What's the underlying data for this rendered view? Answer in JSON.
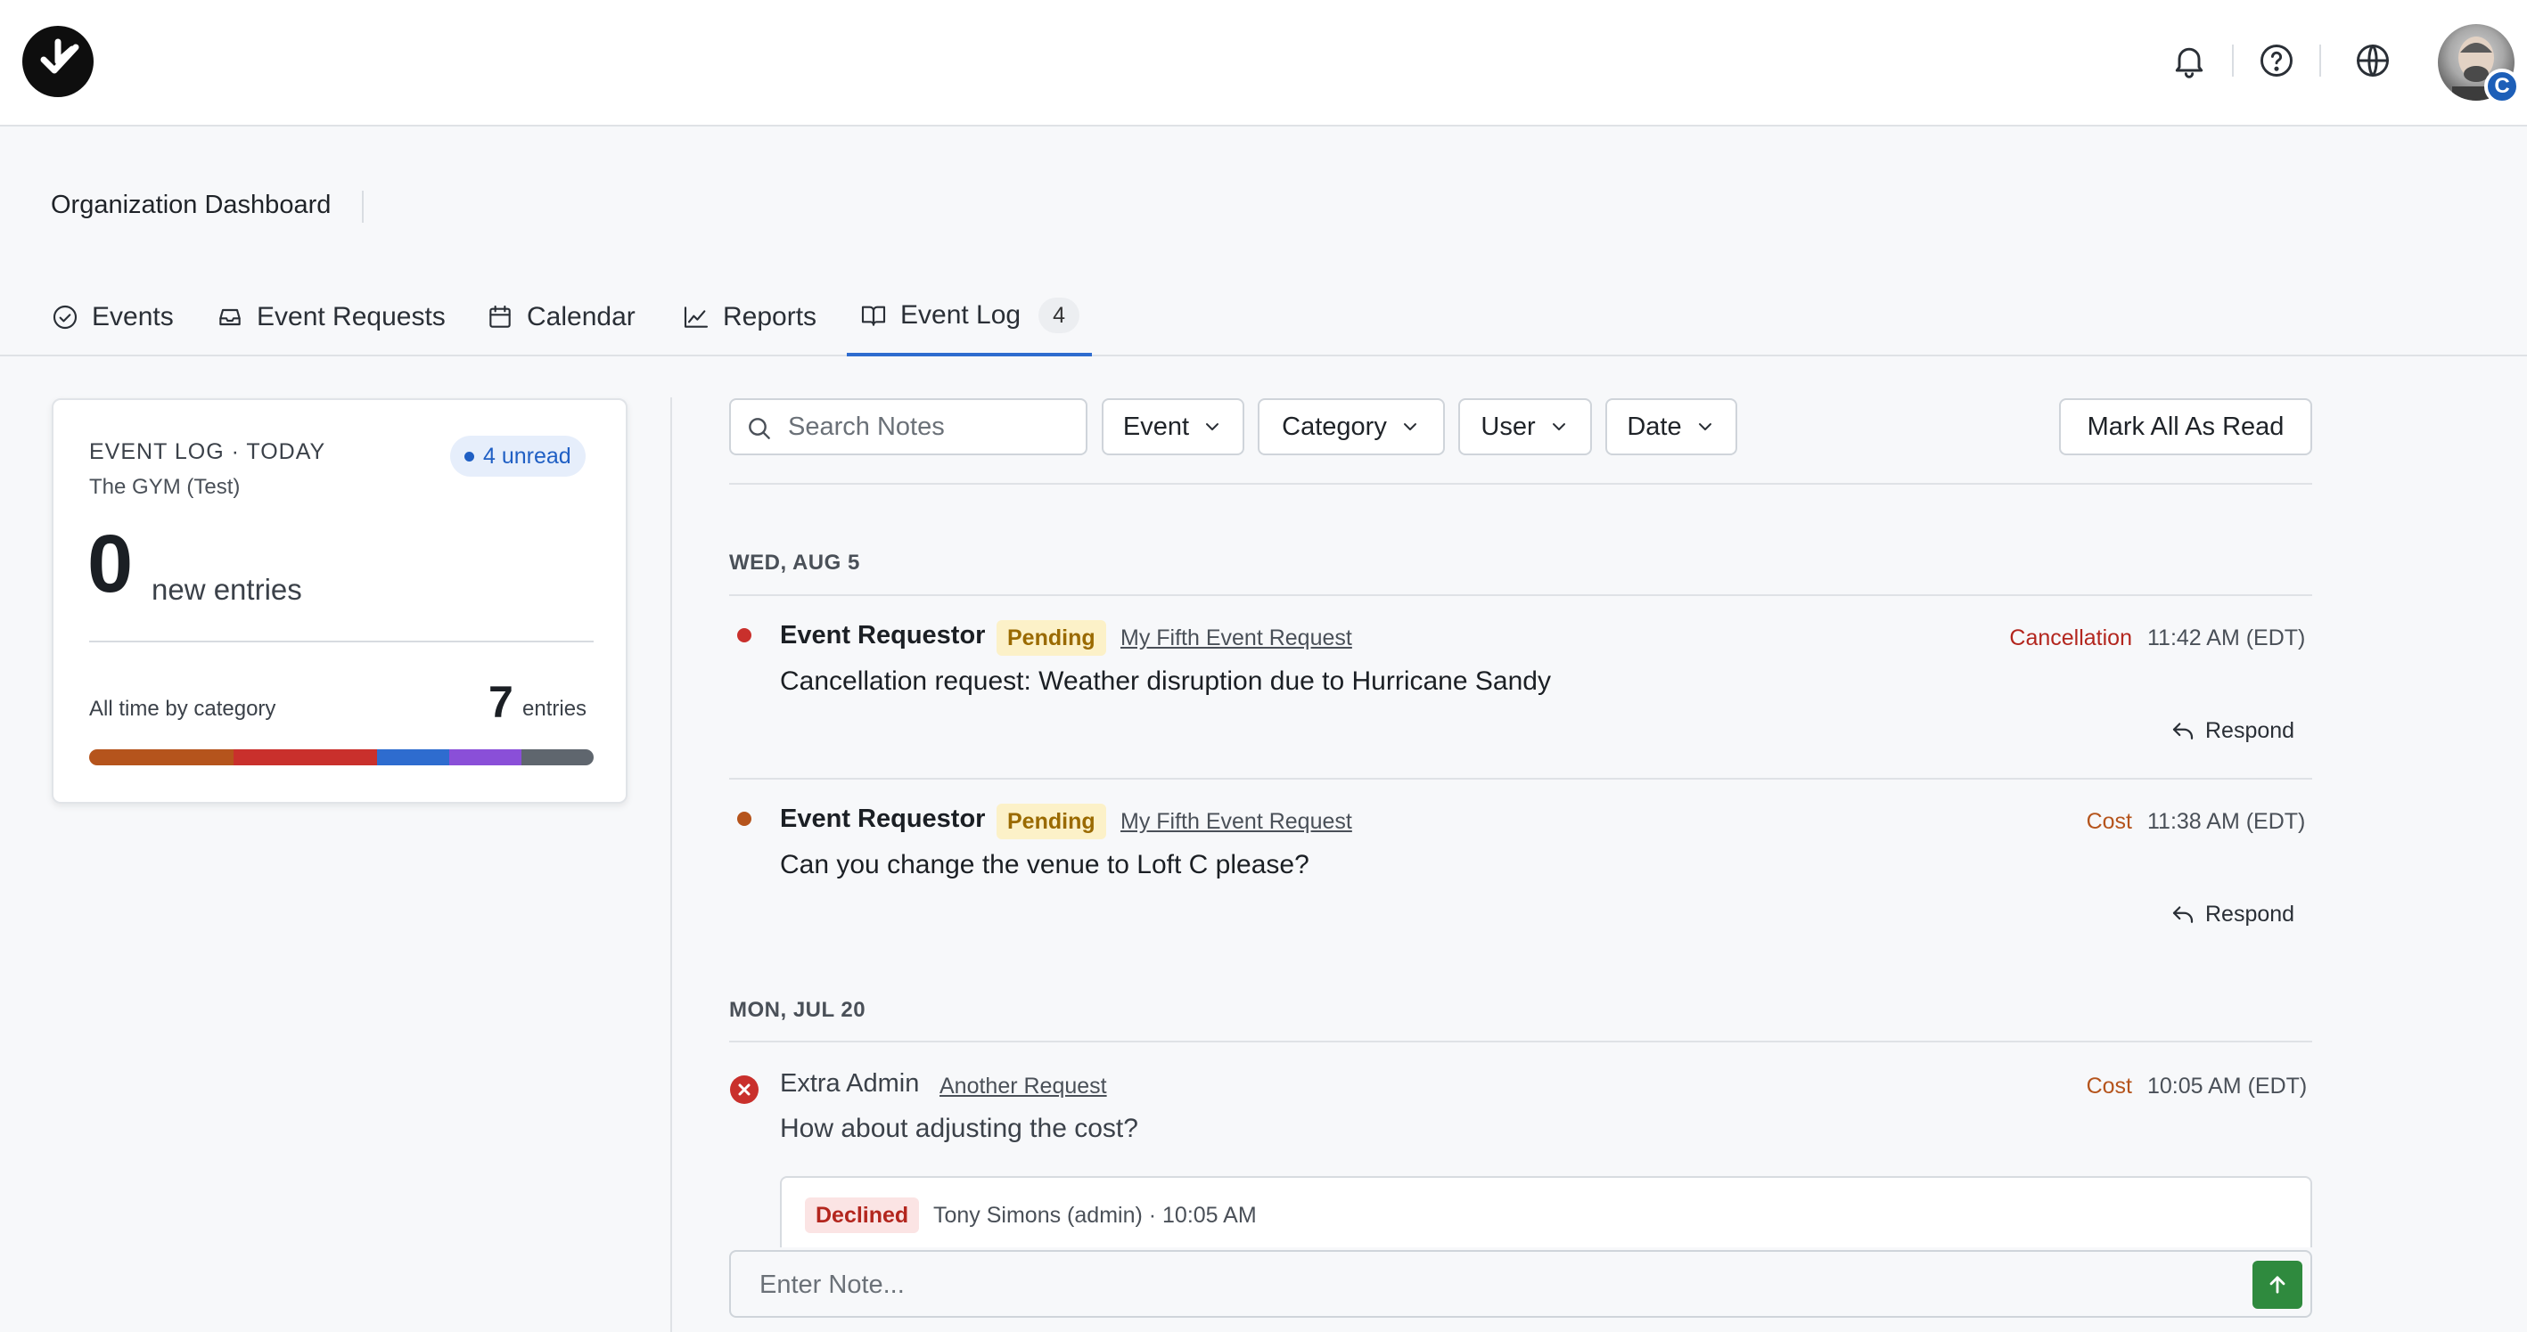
{
  "colors": {
    "accent": "#2e6ccf",
    "unread_dot_red": "#c9302c",
    "unread_dot_orange": "#b5541c",
    "cancellation": "#b3261e",
    "cost": "#b5541c",
    "send": "#2f8a3e"
  },
  "topbar": {
    "icons": [
      "bell-icon",
      "help-circle-icon",
      "globe-icon"
    ],
    "avatar_badge": "C"
  },
  "header": {
    "org_title": "Organization Dashboard"
  },
  "tabs": [
    {
      "label": "Events",
      "icon": "check-circle-icon"
    },
    {
      "label": "Event Requests",
      "icon": "inbox-icon"
    },
    {
      "label": "Calendar",
      "icon": "calendar-icon"
    },
    {
      "label": "Reports",
      "icon": "line-chart-icon"
    },
    {
      "label": "Event Log",
      "icon": "book-open-icon",
      "count": "4",
      "active": true
    }
  ],
  "summary_card": {
    "title": "EVENT LOG · TODAY",
    "subtitle": "The GYM (Test)",
    "unread": "4 unread",
    "new_count": "0",
    "new_label": "new entries",
    "category_label": "All time by category",
    "total_entries": "7",
    "entries_label": "entries",
    "category_segments": [
      {
        "color": "#b5541c",
        "share": 2
      },
      {
        "color": "#c9302c",
        "share": 2
      },
      {
        "color": "#2e6ccf",
        "share": 1
      },
      {
        "color": "#8a4fd8",
        "share": 1
      },
      {
        "color": "#5f666e",
        "share": 1
      }
    ]
  },
  "filters": {
    "search_placeholder": "Search Notes",
    "event_label": "Event",
    "category_label": "Category",
    "user_label": "User",
    "date_label": "Date",
    "mark_all_label": "Mark All As Read"
  },
  "log": {
    "days": [
      {
        "label": "WED, AUG 5",
        "entries": [
          {
            "author": "Event Requestor",
            "status": "Pending",
            "request": "My Fifth Event Request",
            "category": "Cancellation",
            "time": "11:42 AM (EDT)",
            "message": "Cancellation request: Weather disruption due to Hurricane Sandy",
            "respond": "Respond"
          },
          {
            "author": "Event Requestor",
            "status": "Pending",
            "request": "My Fifth Event Request",
            "category": "Cost",
            "time": "11:38 AM (EDT)",
            "message": "Can you change the venue to Loft C please?",
            "respond": "Respond"
          }
        ]
      },
      {
        "label": "MON, JUL 20",
        "entries": [
          {
            "author": "Extra Admin",
            "request": "Another Request",
            "category": "Cost",
            "time": "10:05 AM (EDT)",
            "message": "How about adjusting the cost?",
            "reply": {
              "status": "Declined",
              "meta": "Tony Simons (admin) · 10:05 AM"
            }
          }
        ]
      }
    ]
  },
  "note_input": {
    "placeholder": "Enter Note..."
  }
}
